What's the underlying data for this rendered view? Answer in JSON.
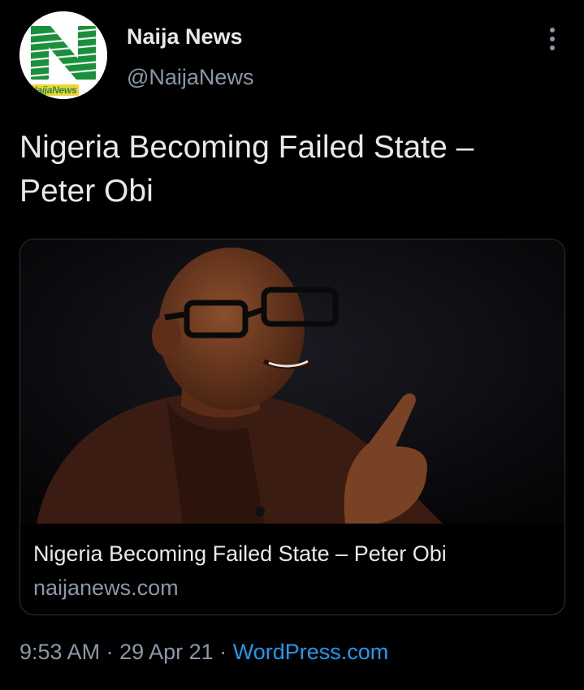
{
  "header": {
    "avatar_icon": "naija-news-logo",
    "avatar_wordmark": "NaijaNews",
    "display_name": "Naija News",
    "handle": "@NaijaNews",
    "more_icon": "vertical-ellipsis-icon"
  },
  "tweet": {
    "text": "Nigeria Becoming Failed State – Peter Obi"
  },
  "card": {
    "image": "photo-of-man-with-glasses-pointing-finger",
    "title": "Nigeria Becoming Failed State – Peter Obi",
    "domain": "naijanews.com"
  },
  "footer": {
    "time": "9:53 AM",
    "separator": "·",
    "date": "29 Apr 21",
    "source": "WordPress.com"
  },
  "colors": {
    "background": "#000000",
    "primary_text": "#e7e9ea",
    "secondary_text": "#8b98a5",
    "link": "#1d9bf0",
    "border": "#2f3336",
    "logo_green": "#1b8f3a"
  }
}
